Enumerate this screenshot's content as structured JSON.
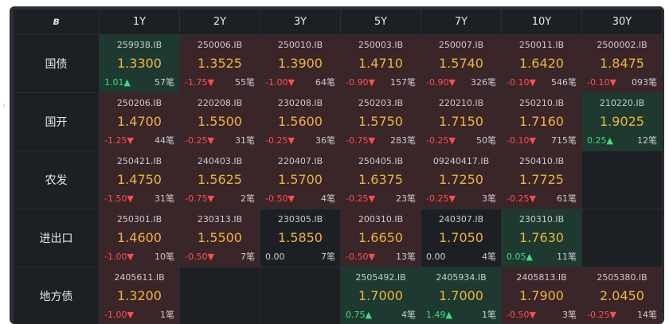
{
  "header": {
    "corner_icon": "ʙ",
    "columns": [
      "1Y",
      "2Y",
      "3Y",
      "5Y",
      "7Y",
      "10Y",
      "30Y"
    ]
  },
  "rows": [
    {
      "label": "国债",
      "cells": [
        {
          "code": "259938.IB",
          "yield": "1.3300",
          "change": "1.01▲",
          "count": "57笔",
          "tone": "green",
          "dir": "up"
        },
        {
          "code": "250006.IB",
          "yield": "1.3525",
          "change": "-1.75▼",
          "count": "55笔",
          "tone": "red",
          "dir": "down"
        },
        {
          "code": "250010.IB",
          "yield": "1.3900",
          "change": "-1.00▼",
          "count": "64笔",
          "tone": "red",
          "dir": "down"
        },
        {
          "code": "250003.IB",
          "yield": "1.4710",
          "change": "-0.90▼",
          "count": "157笔",
          "tone": "red",
          "dir": "down"
        },
        {
          "code": "250007.IB",
          "yield": "1.5740",
          "change": "-0.90▼",
          "count": "326笔",
          "tone": "red",
          "dir": "down"
        },
        {
          "code": "250011.IB",
          "yield": "1.6420",
          "change": "-0.10▼",
          "count": "546笔",
          "tone": "red",
          "dir": "down"
        },
        {
          "code": "2500002.IB",
          "yield": "1.8475",
          "change": "-0.10▼",
          "count": "093笔",
          "tone": "red",
          "dir": "down"
        }
      ]
    },
    {
      "label": "国开",
      "cells": [
        {
          "code": "250206.IB",
          "yield": "1.4700",
          "change": "-1.25▼",
          "count": "44笔",
          "tone": "red",
          "dir": "down"
        },
        {
          "code": "220208.IB",
          "yield": "1.5500",
          "change": "-0.25▼",
          "count": "31笔",
          "tone": "red",
          "dir": "down"
        },
        {
          "code": "230208.IB",
          "yield": "1.5600",
          "change": "-0.25▼",
          "count": "36笔",
          "tone": "red",
          "dir": "down"
        },
        {
          "code": "250203.IB",
          "yield": "1.5750",
          "change": "-0.75▼",
          "count": "283笔",
          "tone": "red",
          "dir": "down"
        },
        {
          "code": "220210.IB",
          "yield": "1.7150",
          "change": "-0.25▼",
          "count": "50笔",
          "tone": "red",
          "dir": "down"
        },
        {
          "code": "250210.IB",
          "yield": "1.7160",
          "change": "-0.10▼",
          "count": "715笔",
          "tone": "red",
          "dir": "down"
        },
        {
          "code": "210220.IB",
          "yield": "1.9025",
          "change": "0.25▲",
          "count": "12笔",
          "tone": "green",
          "dir": "up"
        }
      ]
    },
    {
      "label": "农发",
      "cells": [
        {
          "code": "250421.IB",
          "yield": "1.4750",
          "change": "-1.50▼",
          "count": "31笔",
          "tone": "red",
          "dir": "down"
        },
        {
          "code": "240403.IB",
          "yield": "1.5625",
          "change": "-0.75▼",
          "count": "2笔",
          "tone": "red",
          "dir": "down"
        },
        {
          "code": "220407.IB",
          "yield": "1.5700",
          "change": "-0.50▼",
          "count": "4笔",
          "tone": "red",
          "dir": "down"
        },
        {
          "code": "250405.IB",
          "yield": "1.6375",
          "change": "-0.25▼",
          "count": "23笔",
          "tone": "red",
          "dir": "down"
        },
        {
          "code": "09240417.IB",
          "yield": "1.7250",
          "change": "-0.25▼",
          "count": "3笔",
          "tone": "red",
          "dir": "down"
        },
        {
          "code": "250410.IB",
          "yield": "1.7725",
          "change": "-0.25▼",
          "count": "61笔",
          "tone": "red",
          "dir": "down"
        },
        null
      ]
    },
    {
      "label": "进出口",
      "cells": [
        {
          "code": "250301.IB",
          "yield": "1.4600",
          "change": "-1.00▼",
          "count": "10笔",
          "tone": "red",
          "dir": "down"
        },
        {
          "code": "230313.IB",
          "yield": "1.5500",
          "change": "-0.50▼",
          "count": "7笔",
          "tone": "red",
          "dir": "down"
        },
        {
          "code": "230305.IB",
          "yield": "1.5850",
          "change": "0.00",
          "count": "7笔",
          "tone": "dark",
          "dir": "flat"
        },
        {
          "code": "200310.IB",
          "yield": "1.6650",
          "change": "-0.50▼",
          "count": "13笔",
          "tone": "red",
          "dir": "down"
        },
        {
          "code": "240307.IB",
          "yield": "1.7050",
          "change": "0.00",
          "count": "4笔",
          "tone": "dark",
          "dir": "flat"
        },
        {
          "code": "230310.IB",
          "yield": "1.7630",
          "change": "0.05▲",
          "count": "11笔",
          "tone": "green",
          "dir": "up"
        },
        null
      ]
    },
    {
      "label": "地方债",
      "cells": [
        {
          "code": "2405611.IB",
          "yield": "1.3200",
          "change": "-1.00▼",
          "count": "1笔",
          "tone": "red",
          "dir": "down"
        },
        null,
        null,
        {
          "code": "2505492.IB",
          "yield": "1.7000",
          "change": "0.75▲",
          "count": "4笔",
          "tone": "green",
          "dir": "up"
        },
        {
          "code": "2405934.IB",
          "yield": "1.7000",
          "change": "1.49▲",
          "count": "1笔",
          "tone": "green",
          "dir": "up"
        },
        {
          "code": "2405813.IB",
          "yield": "1.7900",
          "change": "-0.50▼",
          "count": "3笔",
          "tone": "red",
          "dir": "down"
        },
        {
          "code": "2505380.IB",
          "yield": "2.0450",
          "change": "-0.25▼",
          "count": "14笔",
          "tone": "red",
          "dir": "down"
        }
      ]
    }
  ]
}
